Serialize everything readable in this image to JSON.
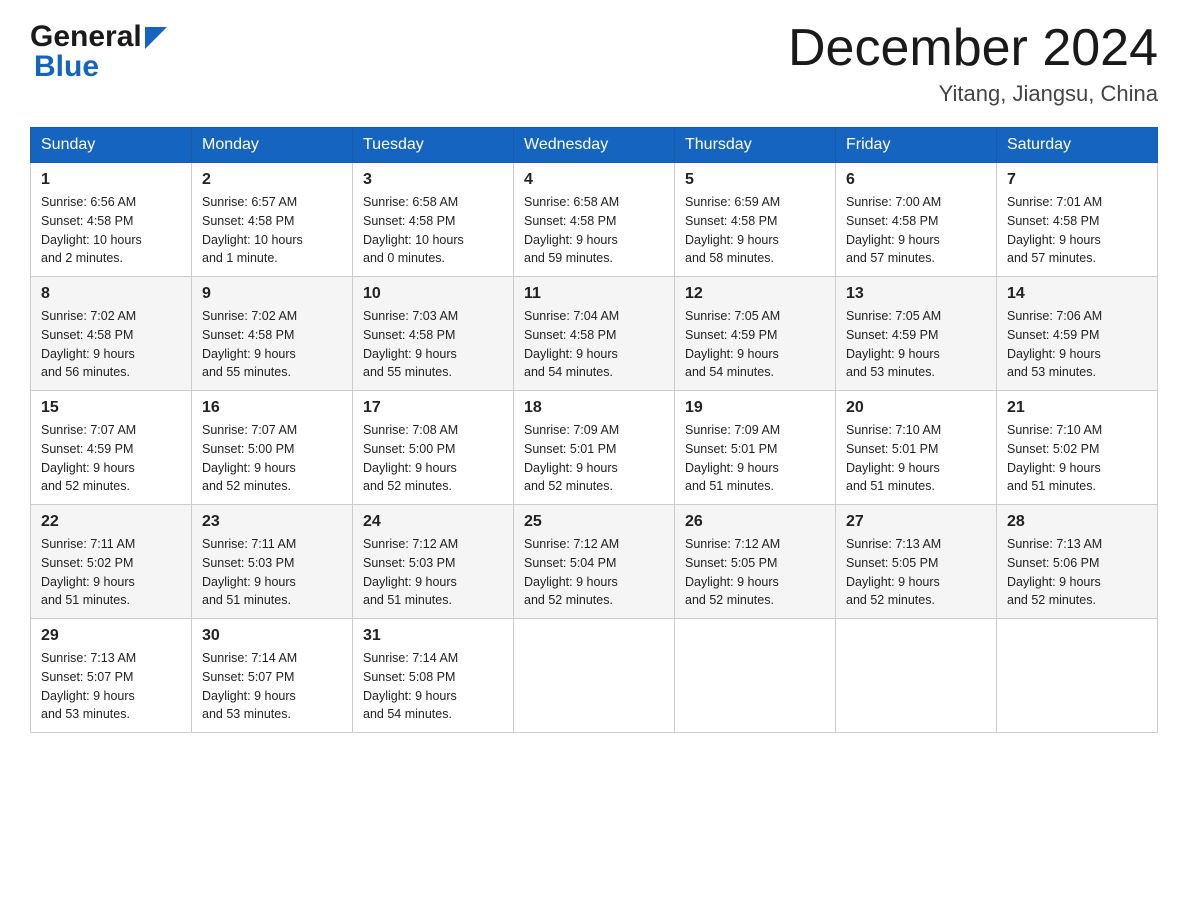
{
  "logo": {
    "general": "General",
    "blue": "Blue",
    "arrow_color": "#1565c0"
  },
  "title": {
    "month_year": "December 2024",
    "location": "Yitang, Jiangsu, China"
  },
  "header_row": {
    "days": [
      "Sunday",
      "Monday",
      "Tuesday",
      "Wednesday",
      "Thursday",
      "Friday",
      "Saturday"
    ]
  },
  "weeks": [
    {
      "cells": [
        {
          "day": "1",
          "sunrise": "6:56 AM",
          "sunset": "4:58 PM",
          "daylight": "10 hours and 2 minutes."
        },
        {
          "day": "2",
          "sunrise": "6:57 AM",
          "sunset": "4:58 PM",
          "daylight": "10 hours and 1 minute."
        },
        {
          "day": "3",
          "sunrise": "6:58 AM",
          "sunset": "4:58 PM",
          "daylight": "10 hours and 0 minutes."
        },
        {
          "day": "4",
          "sunrise": "6:58 AM",
          "sunset": "4:58 PM",
          "daylight": "9 hours and 59 minutes."
        },
        {
          "day": "5",
          "sunrise": "6:59 AM",
          "sunset": "4:58 PM",
          "daylight": "9 hours and 58 minutes."
        },
        {
          "day": "6",
          "sunrise": "7:00 AM",
          "sunset": "4:58 PM",
          "daylight": "9 hours and 57 minutes."
        },
        {
          "day": "7",
          "sunrise": "7:01 AM",
          "sunset": "4:58 PM",
          "daylight": "9 hours and 57 minutes."
        }
      ]
    },
    {
      "cells": [
        {
          "day": "8",
          "sunrise": "7:02 AM",
          "sunset": "4:58 PM",
          "daylight": "9 hours and 56 minutes."
        },
        {
          "day": "9",
          "sunrise": "7:02 AM",
          "sunset": "4:58 PM",
          "daylight": "9 hours and 55 minutes."
        },
        {
          "day": "10",
          "sunrise": "7:03 AM",
          "sunset": "4:58 PM",
          "daylight": "9 hours and 55 minutes."
        },
        {
          "day": "11",
          "sunrise": "7:04 AM",
          "sunset": "4:58 PM",
          "daylight": "9 hours and 54 minutes."
        },
        {
          "day": "12",
          "sunrise": "7:05 AM",
          "sunset": "4:59 PM",
          "daylight": "9 hours and 54 minutes."
        },
        {
          "day": "13",
          "sunrise": "7:05 AM",
          "sunset": "4:59 PM",
          "daylight": "9 hours and 53 minutes."
        },
        {
          "day": "14",
          "sunrise": "7:06 AM",
          "sunset": "4:59 PM",
          "daylight": "9 hours and 53 minutes."
        }
      ]
    },
    {
      "cells": [
        {
          "day": "15",
          "sunrise": "7:07 AM",
          "sunset": "4:59 PM",
          "daylight": "9 hours and 52 minutes."
        },
        {
          "day": "16",
          "sunrise": "7:07 AM",
          "sunset": "5:00 PM",
          "daylight": "9 hours and 52 minutes."
        },
        {
          "day": "17",
          "sunrise": "7:08 AM",
          "sunset": "5:00 PM",
          "daylight": "9 hours and 52 minutes."
        },
        {
          "day": "18",
          "sunrise": "7:09 AM",
          "sunset": "5:01 PM",
          "daylight": "9 hours and 52 minutes."
        },
        {
          "day": "19",
          "sunrise": "7:09 AM",
          "sunset": "5:01 PM",
          "daylight": "9 hours and 51 minutes."
        },
        {
          "day": "20",
          "sunrise": "7:10 AM",
          "sunset": "5:01 PM",
          "daylight": "9 hours and 51 minutes."
        },
        {
          "day": "21",
          "sunrise": "7:10 AM",
          "sunset": "5:02 PM",
          "daylight": "9 hours and 51 minutes."
        }
      ]
    },
    {
      "cells": [
        {
          "day": "22",
          "sunrise": "7:11 AM",
          "sunset": "5:02 PM",
          "daylight": "9 hours and 51 minutes."
        },
        {
          "day": "23",
          "sunrise": "7:11 AM",
          "sunset": "5:03 PM",
          "daylight": "9 hours and 51 minutes."
        },
        {
          "day": "24",
          "sunrise": "7:12 AM",
          "sunset": "5:03 PM",
          "daylight": "9 hours and 51 minutes."
        },
        {
          "day": "25",
          "sunrise": "7:12 AM",
          "sunset": "5:04 PM",
          "daylight": "9 hours and 52 minutes."
        },
        {
          "day": "26",
          "sunrise": "7:12 AM",
          "sunset": "5:05 PM",
          "daylight": "9 hours and 52 minutes."
        },
        {
          "day": "27",
          "sunrise": "7:13 AM",
          "sunset": "5:05 PM",
          "daylight": "9 hours and 52 minutes."
        },
        {
          "day": "28",
          "sunrise": "7:13 AM",
          "sunset": "5:06 PM",
          "daylight": "9 hours and 52 minutes."
        }
      ]
    },
    {
      "cells": [
        {
          "day": "29",
          "sunrise": "7:13 AM",
          "sunset": "5:07 PM",
          "daylight": "9 hours and 53 minutes."
        },
        {
          "day": "30",
          "sunrise": "7:14 AM",
          "sunset": "5:07 PM",
          "daylight": "9 hours and 53 minutes."
        },
        {
          "day": "31",
          "sunrise": "7:14 AM",
          "sunset": "5:08 PM",
          "daylight": "9 hours and 54 minutes."
        },
        null,
        null,
        null,
        null
      ]
    }
  ],
  "labels": {
    "sunrise": "Sunrise:",
    "sunset": "Sunset:",
    "daylight": "Daylight:"
  }
}
